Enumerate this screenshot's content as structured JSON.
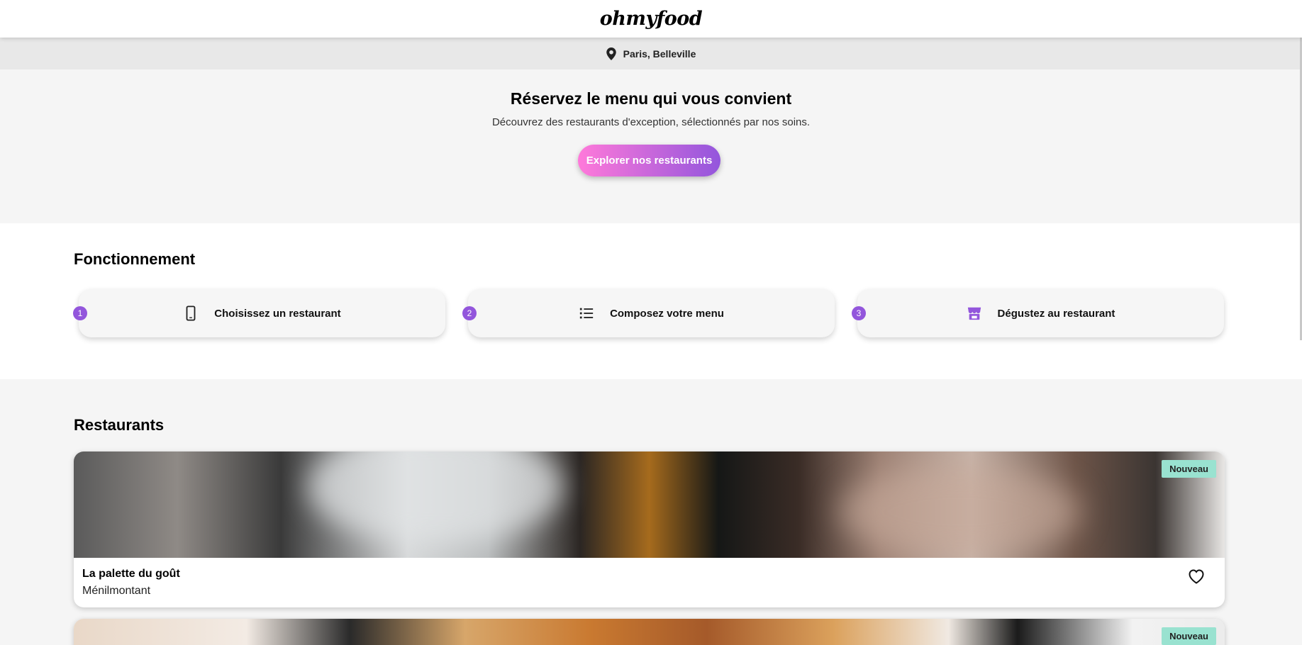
{
  "header": {
    "logo": "ohmyfood"
  },
  "location": {
    "text": "Paris, Belleville",
    "icon": "map-pin-icon"
  },
  "hero": {
    "title": "Réservez le menu qui vous convient",
    "subtitle": "Découvrez des restaurants d'exception, sélectionnés par nos soins.",
    "cta_label": "Explorer nos restaurants",
    "cta_gradient": [
      "#ff79da",
      "#9356dc"
    ]
  },
  "how": {
    "title": "Fonctionnement",
    "steps": [
      {
        "number": "1",
        "label": "Choisissez un restaurant",
        "icon": "mobile-phone-icon"
      },
      {
        "number": "2",
        "label": "Composez votre menu",
        "icon": "list-icon"
      },
      {
        "number": "3",
        "label": "Dégustez au restaurant",
        "icon": "store-icon"
      }
    ],
    "accent_color": "#9356dc"
  },
  "restaurants": {
    "title": "Restaurants",
    "items": [
      {
        "name": "La palette du goût",
        "area": "Ménilmontant",
        "badge": "Nouveau"
      },
      {
        "name": "",
        "area": "",
        "badge": "Nouveau"
      }
    ],
    "badge_color": "#99e2d0"
  }
}
